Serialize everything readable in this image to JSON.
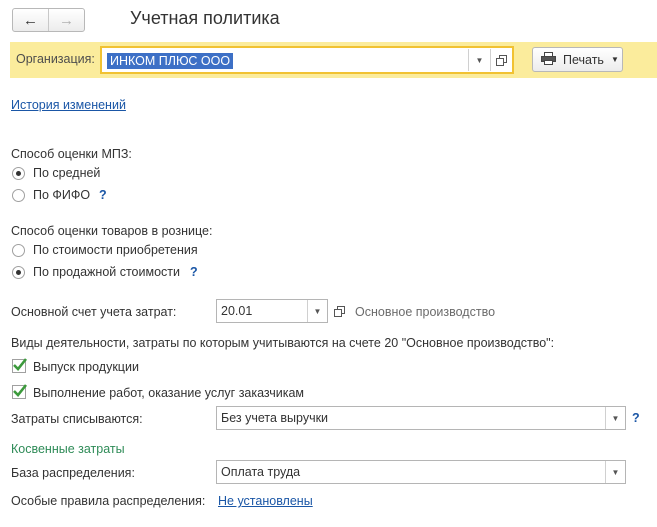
{
  "window": {
    "title": "Учетная политика"
  },
  "nav": {
    "back_icon": "←",
    "forward_icon": "→"
  },
  "org": {
    "label": "Организация:",
    "value": "ИНКОМ ПЛЮС ООО",
    "print_label": "Печать"
  },
  "history_link": "История изменений",
  "mpz": {
    "label": "Способ оценки МПЗ:",
    "options": [
      "По средней",
      "По ФИФО"
    ],
    "selected": 0,
    "help": "?"
  },
  "retail": {
    "label": "Способ оценки товаров в рознице:",
    "options": [
      "По стоимости приобретения",
      "По продажной стоимости"
    ],
    "selected": 1,
    "help": "?"
  },
  "cost_account": {
    "label": "Основной счет учета затрат:",
    "value": "20.01",
    "description": "Основное производство"
  },
  "activities": {
    "label": "Виды деятельности, затраты по которым учитываются на счете 20 \"Основное производство\":",
    "items": [
      {
        "label": "Выпуск продукции",
        "checked": true
      },
      {
        "label": "Выполнение работ, оказание услуг заказчикам",
        "checked": true
      }
    ]
  },
  "writeoff": {
    "label": "Затраты списываются:",
    "value": "Без учета выручки",
    "help": "?"
  },
  "indirect": {
    "section": "Косвенные затраты",
    "base_label": "База распределения:",
    "base_value": "Оплата труда",
    "rules_label": "Особые правила распределения:",
    "rules_link": "Не установлены"
  },
  "colors": {
    "highlight_bar": "#fbec9c",
    "field_focus": "#f1c232",
    "link": "#1a56a6",
    "section_green": "#2e8b57",
    "check_green": "#3c9a3c"
  }
}
